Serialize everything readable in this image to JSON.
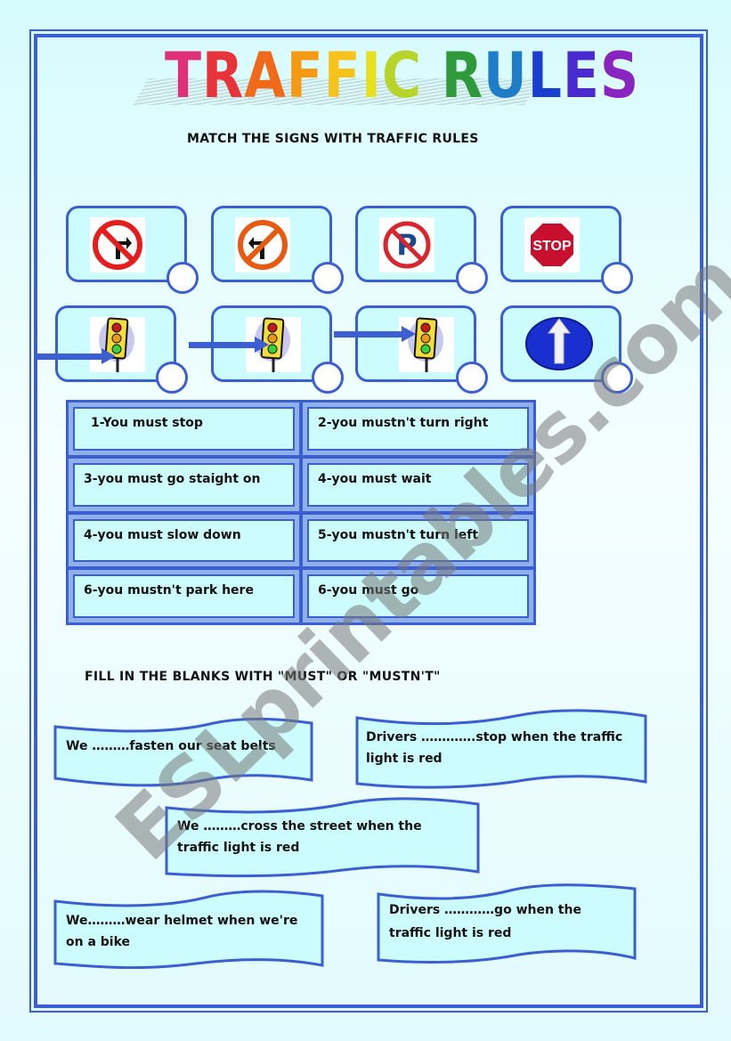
{
  "title": {
    "text": "TRAFFIC RULES",
    "letters": [
      "T",
      "R",
      "A",
      "F",
      "F",
      "I",
      "C",
      " ",
      "R",
      "U",
      "L",
      "E",
      "S"
    ],
    "letter_colors": [
      "#e0307a",
      "#e8333a",
      "#f06a1a",
      "#f59a12",
      "#f7c21a",
      "#e7e01c",
      "#b8d42a",
      "",
      "#2e9a3a",
      "#1f7dc8",
      "#1a3fd0",
      "#4a2bd0",
      "#8a24c0"
    ]
  },
  "section1": {
    "heading": "MATCH THE SIGNS WITH TRAFFIC RULES",
    "signs": [
      {
        "id": "no-right-turn",
        "icon": "no-right-turn-sign-icon"
      },
      {
        "id": "no-left-turn",
        "icon": "no-left-turn-sign-icon"
      },
      {
        "id": "no-parking",
        "icon": "no-parking-sign-icon",
        "letter": "P"
      },
      {
        "id": "stop",
        "icon": "stop-sign-icon",
        "label": "STOP"
      },
      {
        "id": "green-light",
        "icon": "traffic-light-green-icon"
      },
      {
        "id": "amber-light",
        "icon": "traffic-light-amber-icon"
      },
      {
        "id": "red-light",
        "icon": "traffic-light-red-icon"
      },
      {
        "id": "ahead-only",
        "icon": "ahead-only-sign-icon"
      }
    ],
    "rules": [
      "1-You must stop",
      "2-you mustn't turn right",
      "3-you must go staight on",
      "4-you must wait",
      "4-you must slow down",
      "5-you mustn't turn left",
      "6-you mustn't park here",
      "6-you must go"
    ]
  },
  "section2": {
    "heading": "FILL IN THE BLANKS WITH \"MUST\" OR \"MUSTN'T\"",
    "sentences": [
      {
        "line1": "We ………fasten our seat belts",
        "line2": ""
      },
      {
        "line1": "Drivers ………….stop when the traffic",
        "line2": "light is red"
      },
      {
        "line1": "We ………cross the street when the",
        "line2": "traffic light is red"
      },
      {
        "line1": "We………wear helmet when we're",
        "line2": "on a bike"
      },
      {
        "line1": "Drivers …………go when the",
        "line2": "traffic light is red"
      }
    ]
  },
  "watermark": "ESLprintables.com",
  "colors": {
    "accent": "#3b5fd0",
    "card_fill": "#ccfcfd",
    "stop_red": "#c8102e",
    "sign_blue": "#1a2fd0"
  }
}
